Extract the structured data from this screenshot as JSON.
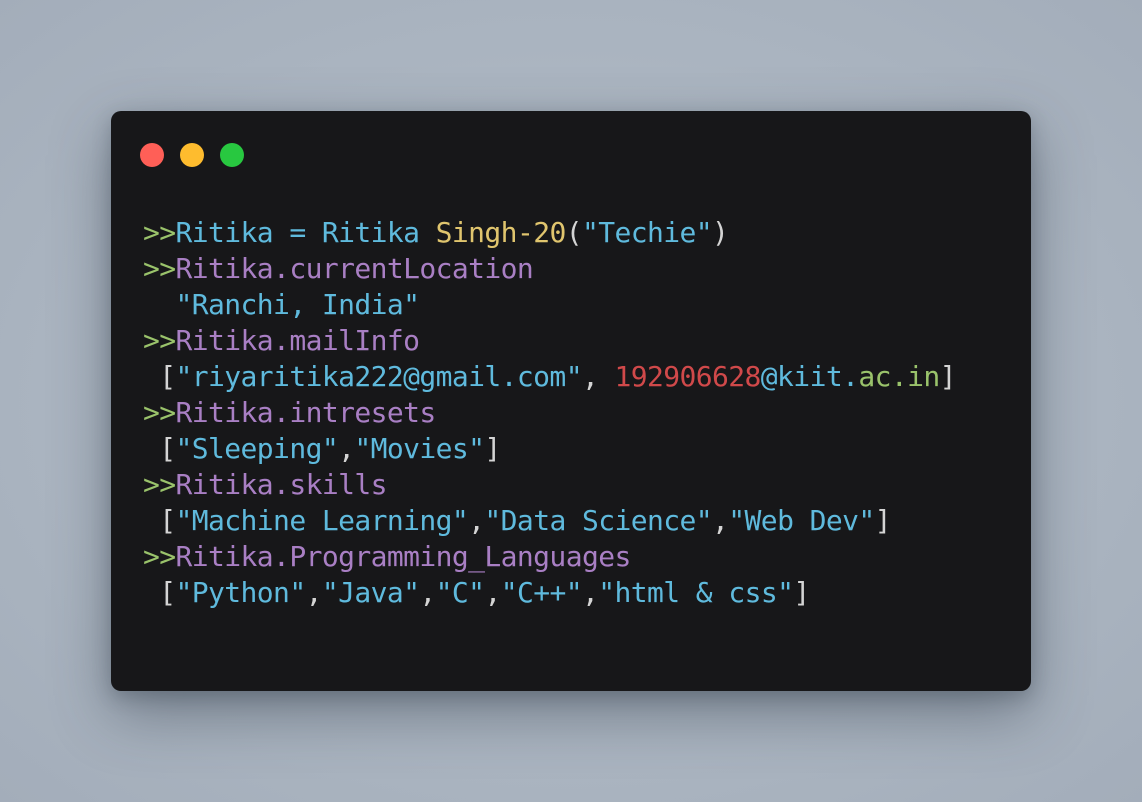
{
  "window": {
    "controls": [
      {
        "name": "close",
        "color": "#ff5f57"
      },
      {
        "name": "minimize",
        "color": "#febc2e"
      },
      {
        "name": "maximize",
        "color": "#28c840"
      }
    ]
  },
  "colors": {
    "prompt": "#9ac36b",
    "identifier": "#5fbadd",
    "property": "#a97fc4",
    "function": "#e0c56e",
    "number": "#d0494a",
    "background": "#171719"
  },
  "code": {
    "prompt": ">>",
    "line1": {
      "var": "Ritika",
      "eq": " = ",
      "cls": "Ritika ",
      "fn": "Singh-20",
      "open": "(",
      "arg": "\"Techie\"",
      "close": ")"
    },
    "line2": {
      "expr": "Ritika.currentLocation"
    },
    "line3": {
      "indent": "  ",
      "value": "\"Ranchi, India\""
    },
    "line4": {
      "expr": "Ritika.mailInfo"
    },
    "line5": {
      "open": " [",
      "email1": "\"riyaritika222@gmail.com\"",
      "sep": ", ",
      "num": "192906628",
      "at": "@kiit.",
      "domain": "ac.in",
      "close": "]"
    },
    "line6": {
      "expr": "Ritika.intresets"
    },
    "line7": {
      "open": " [",
      "items": [
        "\"Sleeping\"",
        "\"Movies\""
      ],
      "comma": ",",
      "close": "]"
    },
    "line8": {
      "expr": "Ritika.skills"
    },
    "line9": {
      "open": " [",
      "items": [
        "\"Machine Learning\"",
        "\"Data Science\"",
        "\"Web Dev\""
      ],
      "comma": ",",
      "close": "]"
    },
    "line10": {
      "expr": "Ritika.Programming_Languages"
    },
    "line11": {
      "open": " [",
      "items": [
        "\"Python\"",
        "\"Java\"",
        "\"C\"",
        "\"C++\"",
        "\"html & css\""
      ],
      "comma": ",",
      "close": "]"
    }
  }
}
